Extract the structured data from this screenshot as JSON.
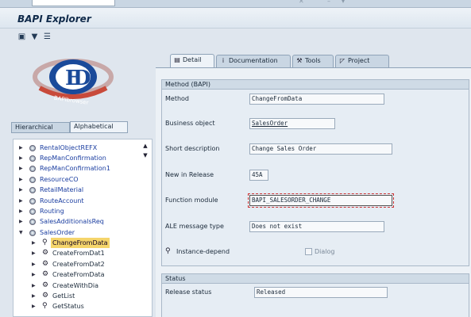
{
  "window": {
    "title": "BAPI Explorer"
  },
  "toolbar": {
    "icons": [
      "hierarchy-icon",
      "filter-icon",
      "list-icon"
    ]
  },
  "logo": {
    "text": "BAPIbrowser"
  },
  "tree_tabs": {
    "hierarchical": "Hierarchical",
    "alphabetical": "Alphabetical"
  },
  "tree": {
    "nodes": [
      {
        "label": "RentalObjectREFX"
      },
      {
        "label": "RepManConfirmation"
      },
      {
        "label": "RepManConfirmation1"
      },
      {
        "label": "ResourceCO"
      },
      {
        "label": "RetailMaterial"
      },
      {
        "label": "RouteAccount"
      },
      {
        "label": "Routing"
      },
      {
        "label": "SalesAdditionalsReq"
      },
      {
        "label": "SalesOrder"
      }
    ],
    "children": [
      {
        "label": "ChangeFromData",
        "selected": true
      },
      {
        "label": "CreateFromDat1"
      },
      {
        "label": "CreateFromDat2"
      },
      {
        "label": "CreateFromData"
      },
      {
        "label": "CreateWithDia"
      },
      {
        "label": "GetList"
      },
      {
        "label": "GetStatus"
      }
    ]
  },
  "tabs": [
    {
      "label": "Detail",
      "icon": "detail-icon",
      "active": true
    },
    {
      "label": "Documentation",
      "icon": "info-icon",
      "active": false
    },
    {
      "label": "Tools",
      "icon": "tools-icon",
      "active": false
    },
    {
      "label": "Project",
      "icon": "project-icon",
      "active": false
    }
  ],
  "method_group": {
    "header": "Method (BAPI)",
    "fields": [
      {
        "label": "Method",
        "value": "ChangeFromData"
      },
      {
        "label": "Business object",
        "value": "SalesOrder"
      },
      {
        "label": "Short description",
        "value": "Change Sales Order"
      },
      {
        "label": "New in Release",
        "value": "45A"
      },
      {
        "label": "Function module",
        "value": "BAPI_SALESORDER_CHANGE"
      },
      {
        "label": "ALE message type",
        "value": "Does not exist"
      }
    ],
    "instance_label": "Instance-depend",
    "dialog_label": "Dialog"
  },
  "status_group": {
    "header": "Status",
    "release_label": "Release status",
    "release_value": "Released"
  }
}
